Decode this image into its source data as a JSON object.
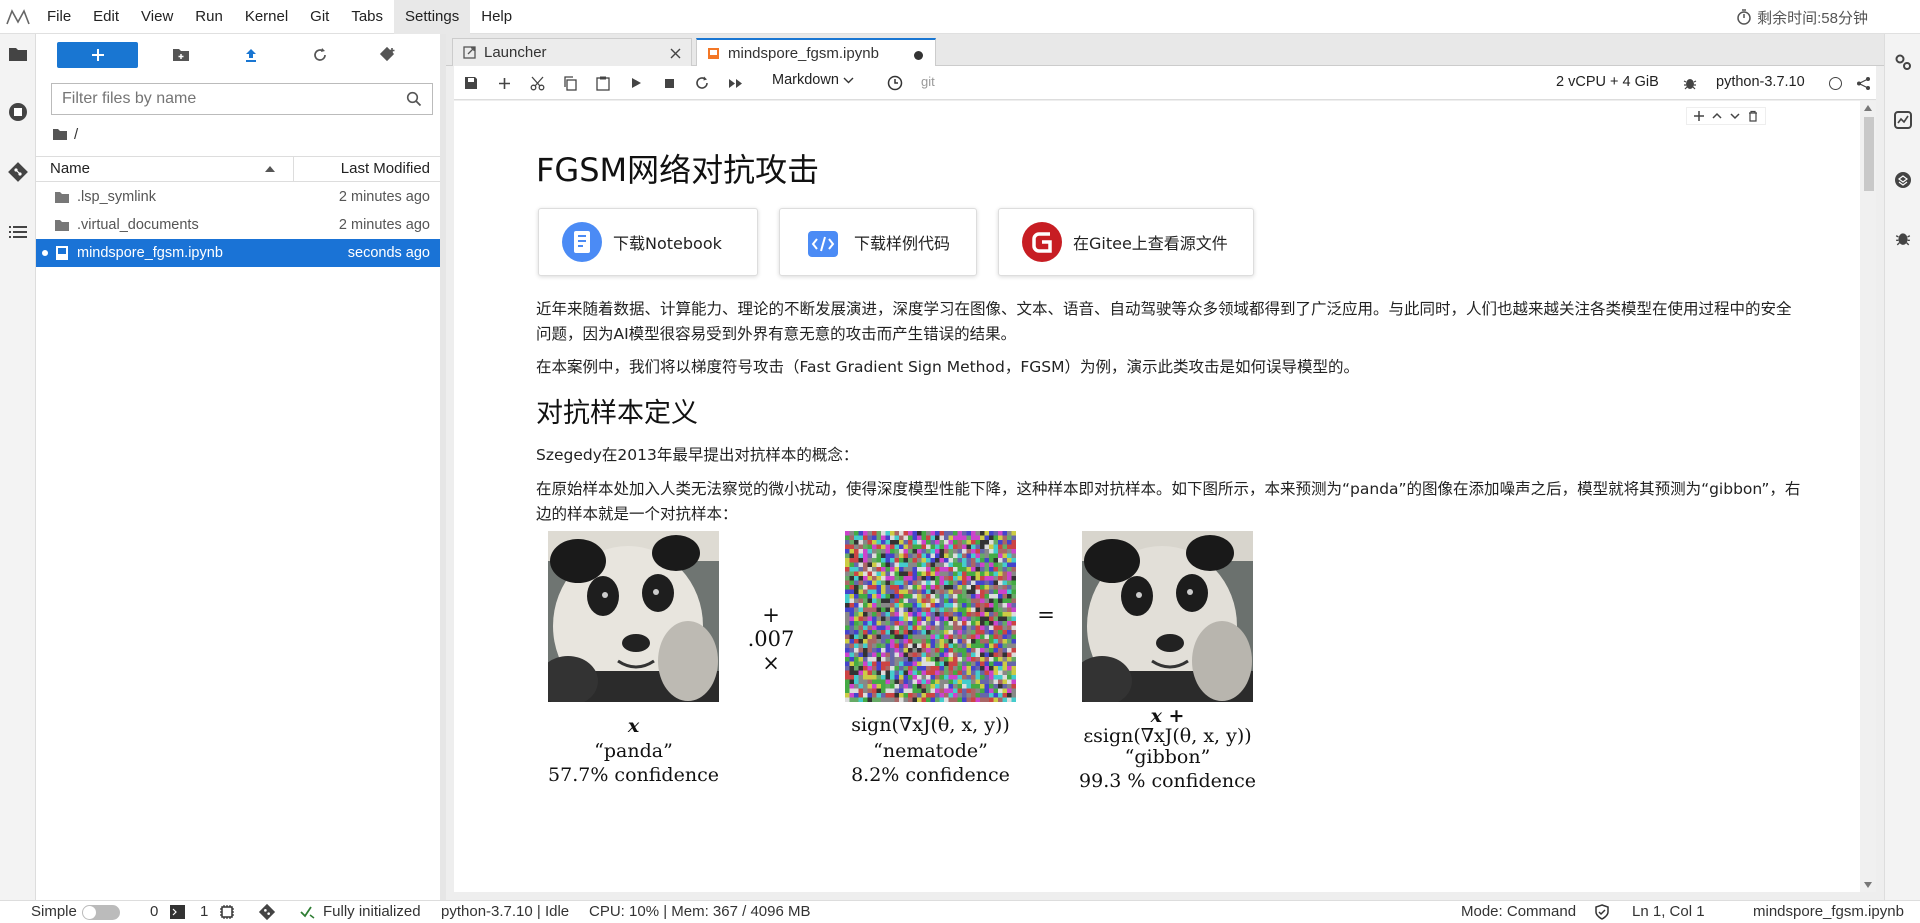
{
  "menubar": {
    "items": [
      "File",
      "Edit",
      "View",
      "Run",
      "Kernel",
      "Git",
      "Tabs",
      "Settings",
      "Help"
    ],
    "timer": "剩余时间:58分钟"
  },
  "filebrowser": {
    "filter_placeholder": "Filter files by name",
    "breadcrumb": "/",
    "col_name": "Name",
    "col_modified": "Last Modified",
    "files": [
      {
        "name": ".lsp_symlink",
        "modified": "2 minutes ago"
      },
      {
        "name": ".virtual_documents",
        "modified": "2 minutes ago"
      },
      {
        "name": "mindspore_fgsm.ipynb",
        "modified": "seconds ago"
      }
    ]
  },
  "tabs": {
    "launcher": "Launcher",
    "notebook": "mindspore_fgsm.ipynb"
  },
  "toolbar": {
    "cell_type": "Markdown",
    "git": "git",
    "resources": "2 vCPU + 4 GiB",
    "kernel": "python-3.7.10"
  },
  "notebook": {
    "title": "FGSM网络对抗攻击",
    "btn_download_notebook": "下载Notebook",
    "btn_download_code": "下载样例代码",
    "btn_gitee": "在Gitee上查看源文件",
    "p1_line1": "近年来随着数据、计算能力、理论的不断发展演进，深度学习在图像、文本、语音、自动驾驶等众多领域都得到了广泛应用。与此同时，人们也越来越关注各类模型在使用过程中的安全",
    "p1_line2": "问题，因为AI模型很容易受到外界有意无意的攻击而产生错误的结果。",
    "p2": "在本案例中，我们将以梯度符号攻击（Fast Gradient Sign Method，FGSM）为例，演示此类攻击是如何误导模型的。",
    "h2": "对抗样本定义",
    "p3": "Szegedy在2013年最早提出对抗样本的概念：",
    "p4_line1": "在原始样本处加入人类无法察觉的微小扰动，使得深度模型性能下降，这种样本即对抗样本。如下图所示，本来预测为“panda”的图像在添加噪声之后，模型就将其预测为“gibbon”，右",
    "p4_line2": "边的样本就是一个对抗样本："
  },
  "figure": {
    "x_label": "x",
    "mult": "+ .007 ×",
    "equals": "=",
    "noise_label": "sign(∇xJ(θ, x, y))",
    "result_label_1": "x +",
    "result_label_2": "εsign(∇xJ(θ, x, y))",
    "panda_name": "“panda”",
    "panda_conf": "57.7% confidence",
    "nematode_name": "“nematode”",
    "nematode_conf": "8.2% confidence",
    "gibbon_name": "“gibbon”",
    "gibbon_conf": "99.3 % confidence"
  },
  "statusbar": {
    "mode_label": "Simple",
    "terminals": "0",
    "kernels": "1",
    "git_status": "Fully initialized",
    "kernel_status": "python-3.7.10 | Idle",
    "cpu_mem": "CPU: 10% | Mem: 367 / 4096 MB",
    "command_mode": "Mode: Command",
    "position": "Ln 1, Col 1",
    "filename": "mindspore_fgsm.ipynb"
  },
  "colors": {
    "accent": "#1976d2",
    "selected_row": "#1a73d6"
  }
}
